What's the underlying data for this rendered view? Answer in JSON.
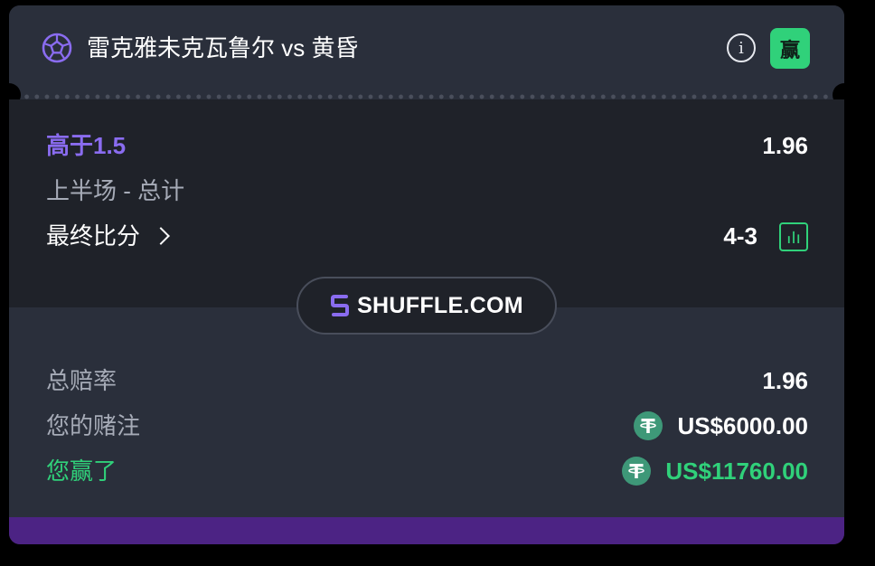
{
  "header": {
    "sport_icon": "soccer-ball-icon",
    "match_title": "雷克雅未克瓦鲁尔 vs 黄昏",
    "info_icon": "info-icon",
    "status_badge": "赢"
  },
  "bet": {
    "selection": "高于1.5",
    "odds": "1.96",
    "market": "上半场 - 总计",
    "final_score_label": "最终比分",
    "final_score": "4-3",
    "stats_icon": "bar-chart-icon"
  },
  "brand": {
    "logo_icon": "shuffle-logo-icon",
    "name": "SHUFFLE.COM"
  },
  "summary": {
    "total_odds_label": "总赔率",
    "total_odds": "1.96",
    "stake_label": "您的赌注",
    "stake": "US$6000.00",
    "payout_label": "您赢了",
    "payout": "US$11760.00",
    "currency_icon": "tether-icon"
  },
  "colors": {
    "accent_purple": "#8a6cf0",
    "win_green": "#30d17a",
    "footer_purple": "#4c2384",
    "card_bg": "#2a2f3b",
    "section_bg": "#1f2229"
  }
}
